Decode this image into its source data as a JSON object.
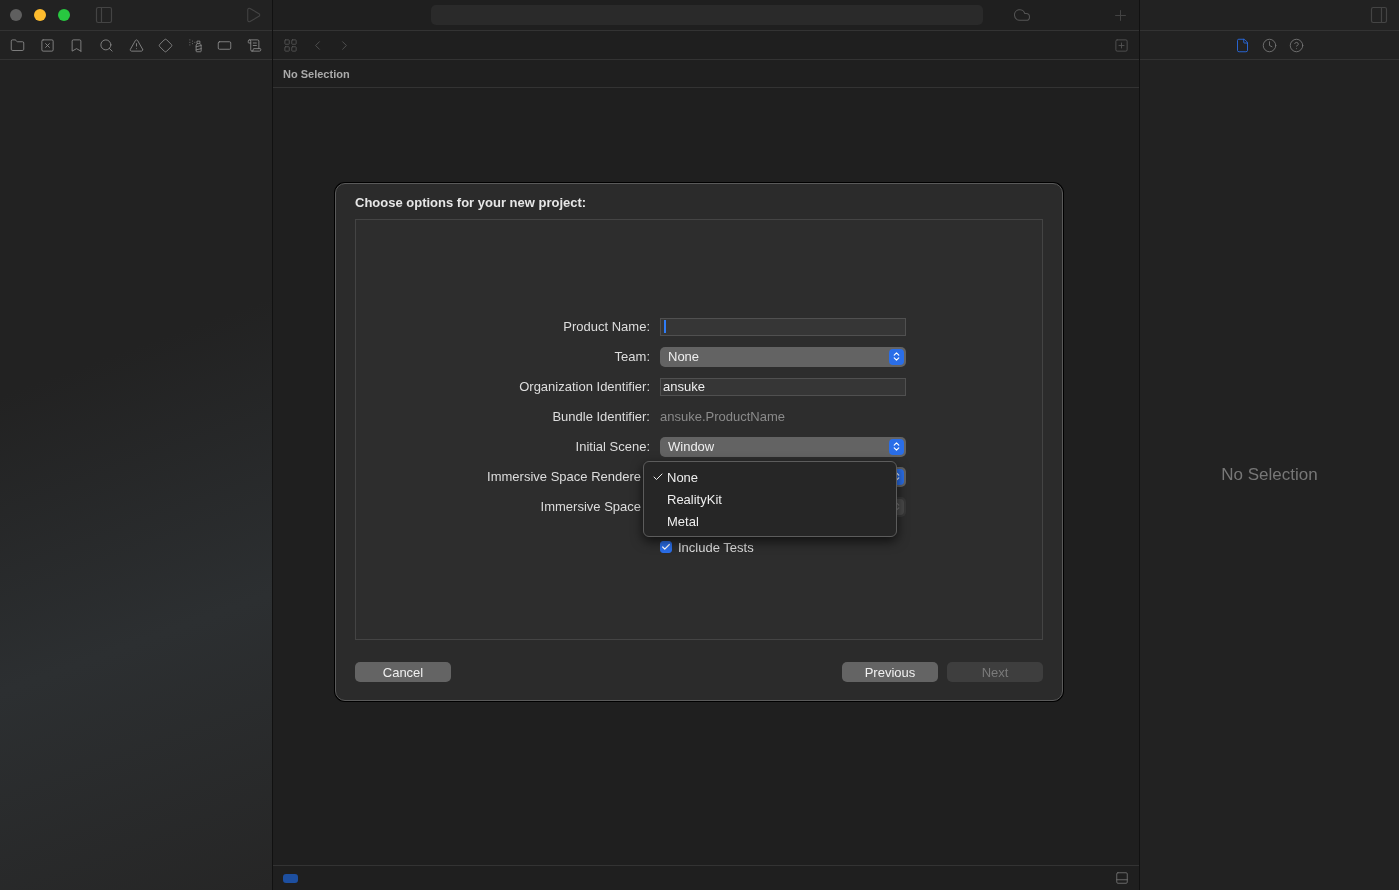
{
  "editor": {
    "breadcrumb": "No Selection"
  },
  "inspector": {
    "placeholder": "No Selection"
  },
  "dialog": {
    "title": "Choose options for your new project:",
    "fields": [
      {
        "kind": "text",
        "label": "Product Name:",
        "focused": true
      },
      {
        "kind": "popup",
        "label": "Team:",
        "value": "None",
        "disabled": false
      },
      {
        "kind": "text",
        "label": "Organization Identifier:",
        "value": "ansuke",
        "focused": false
      },
      {
        "kind": "static",
        "label": "Bundle Identifier:",
        "value": "ansuke.ProductName"
      },
      {
        "kind": "popup",
        "label": "Initial Scene:",
        "value": "Window",
        "disabled": false
      },
      {
        "kind": "popup",
        "label": "Immersive Space Rendere",
        "disabled": false,
        "covered": true
      },
      {
        "kind": "popup",
        "label": "Immersive Space",
        "disabled": true,
        "covered": true
      },
      {
        "kind": "checkbox",
        "label": "Include Tests",
        "checked": true
      }
    ],
    "menu": [
      {
        "label": "None",
        "selected": true
      },
      {
        "label": "RealityKit",
        "selected": false
      },
      {
        "label": "Metal",
        "selected": false
      }
    ],
    "buttons": [
      {
        "label": "Cancel",
        "disabled": false
      },
      {
        "label": "Previous",
        "disabled": false
      },
      {
        "label": "Next",
        "disabled": true
      }
    ]
  }
}
